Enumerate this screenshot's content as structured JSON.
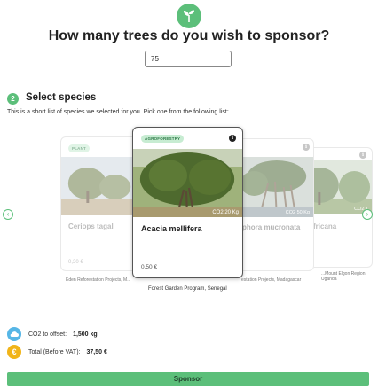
{
  "header": {
    "logo_icon": "sprout-icon",
    "title": "How many trees do you wish to sponsor?"
  },
  "quantity": {
    "value": "75"
  },
  "species_step": {
    "number": "2",
    "title": "Select species",
    "description": "This is a short list of species we selected for you. Pick one from the following list:"
  },
  "carousel": {
    "prev_icon": "chevron-left-icon",
    "next_icon": "chevron-right-icon",
    "cards": [
      {
        "tag": "PLANT",
        "co2": "",
        "name": "Ceriops tagal",
        "price": "0,30 €",
        "project": "Eden Reforestation Projects, M..."
      },
      {
        "tag": "AGROFORESTRY",
        "co2": "CO2 20 Kg",
        "name": "Acacia mellifera",
        "price": "0,50 €",
        "project": "Forest Garden Program, Senegal"
      },
      {
        "tag": "",
        "co2": "CO2 50 Kg",
        "name": "phora mucronata",
        "price": "",
        "project": "estation Projects, Madagascar"
      },
      {
        "tag": "",
        "co2": "CO2 1",
        "name": "fricana",
        "price": "",
        "project": "...Mount Elgon Region, Uganda"
      }
    ]
  },
  "summary": {
    "co2_label": "CO2 to offset:",
    "co2_value": "1,500 kg",
    "total_label": "Total (Before VAT):",
    "total_value": "37,50 €",
    "euro_symbol": "€"
  },
  "sponsor_button": {
    "label": "Sponsor"
  },
  "colors": {
    "accent": "#5cbf7a",
    "tag_bg": "#c7ecd2",
    "co2_icon": "#56b6e6",
    "euro_icon": "#f1b419"
  }
}
